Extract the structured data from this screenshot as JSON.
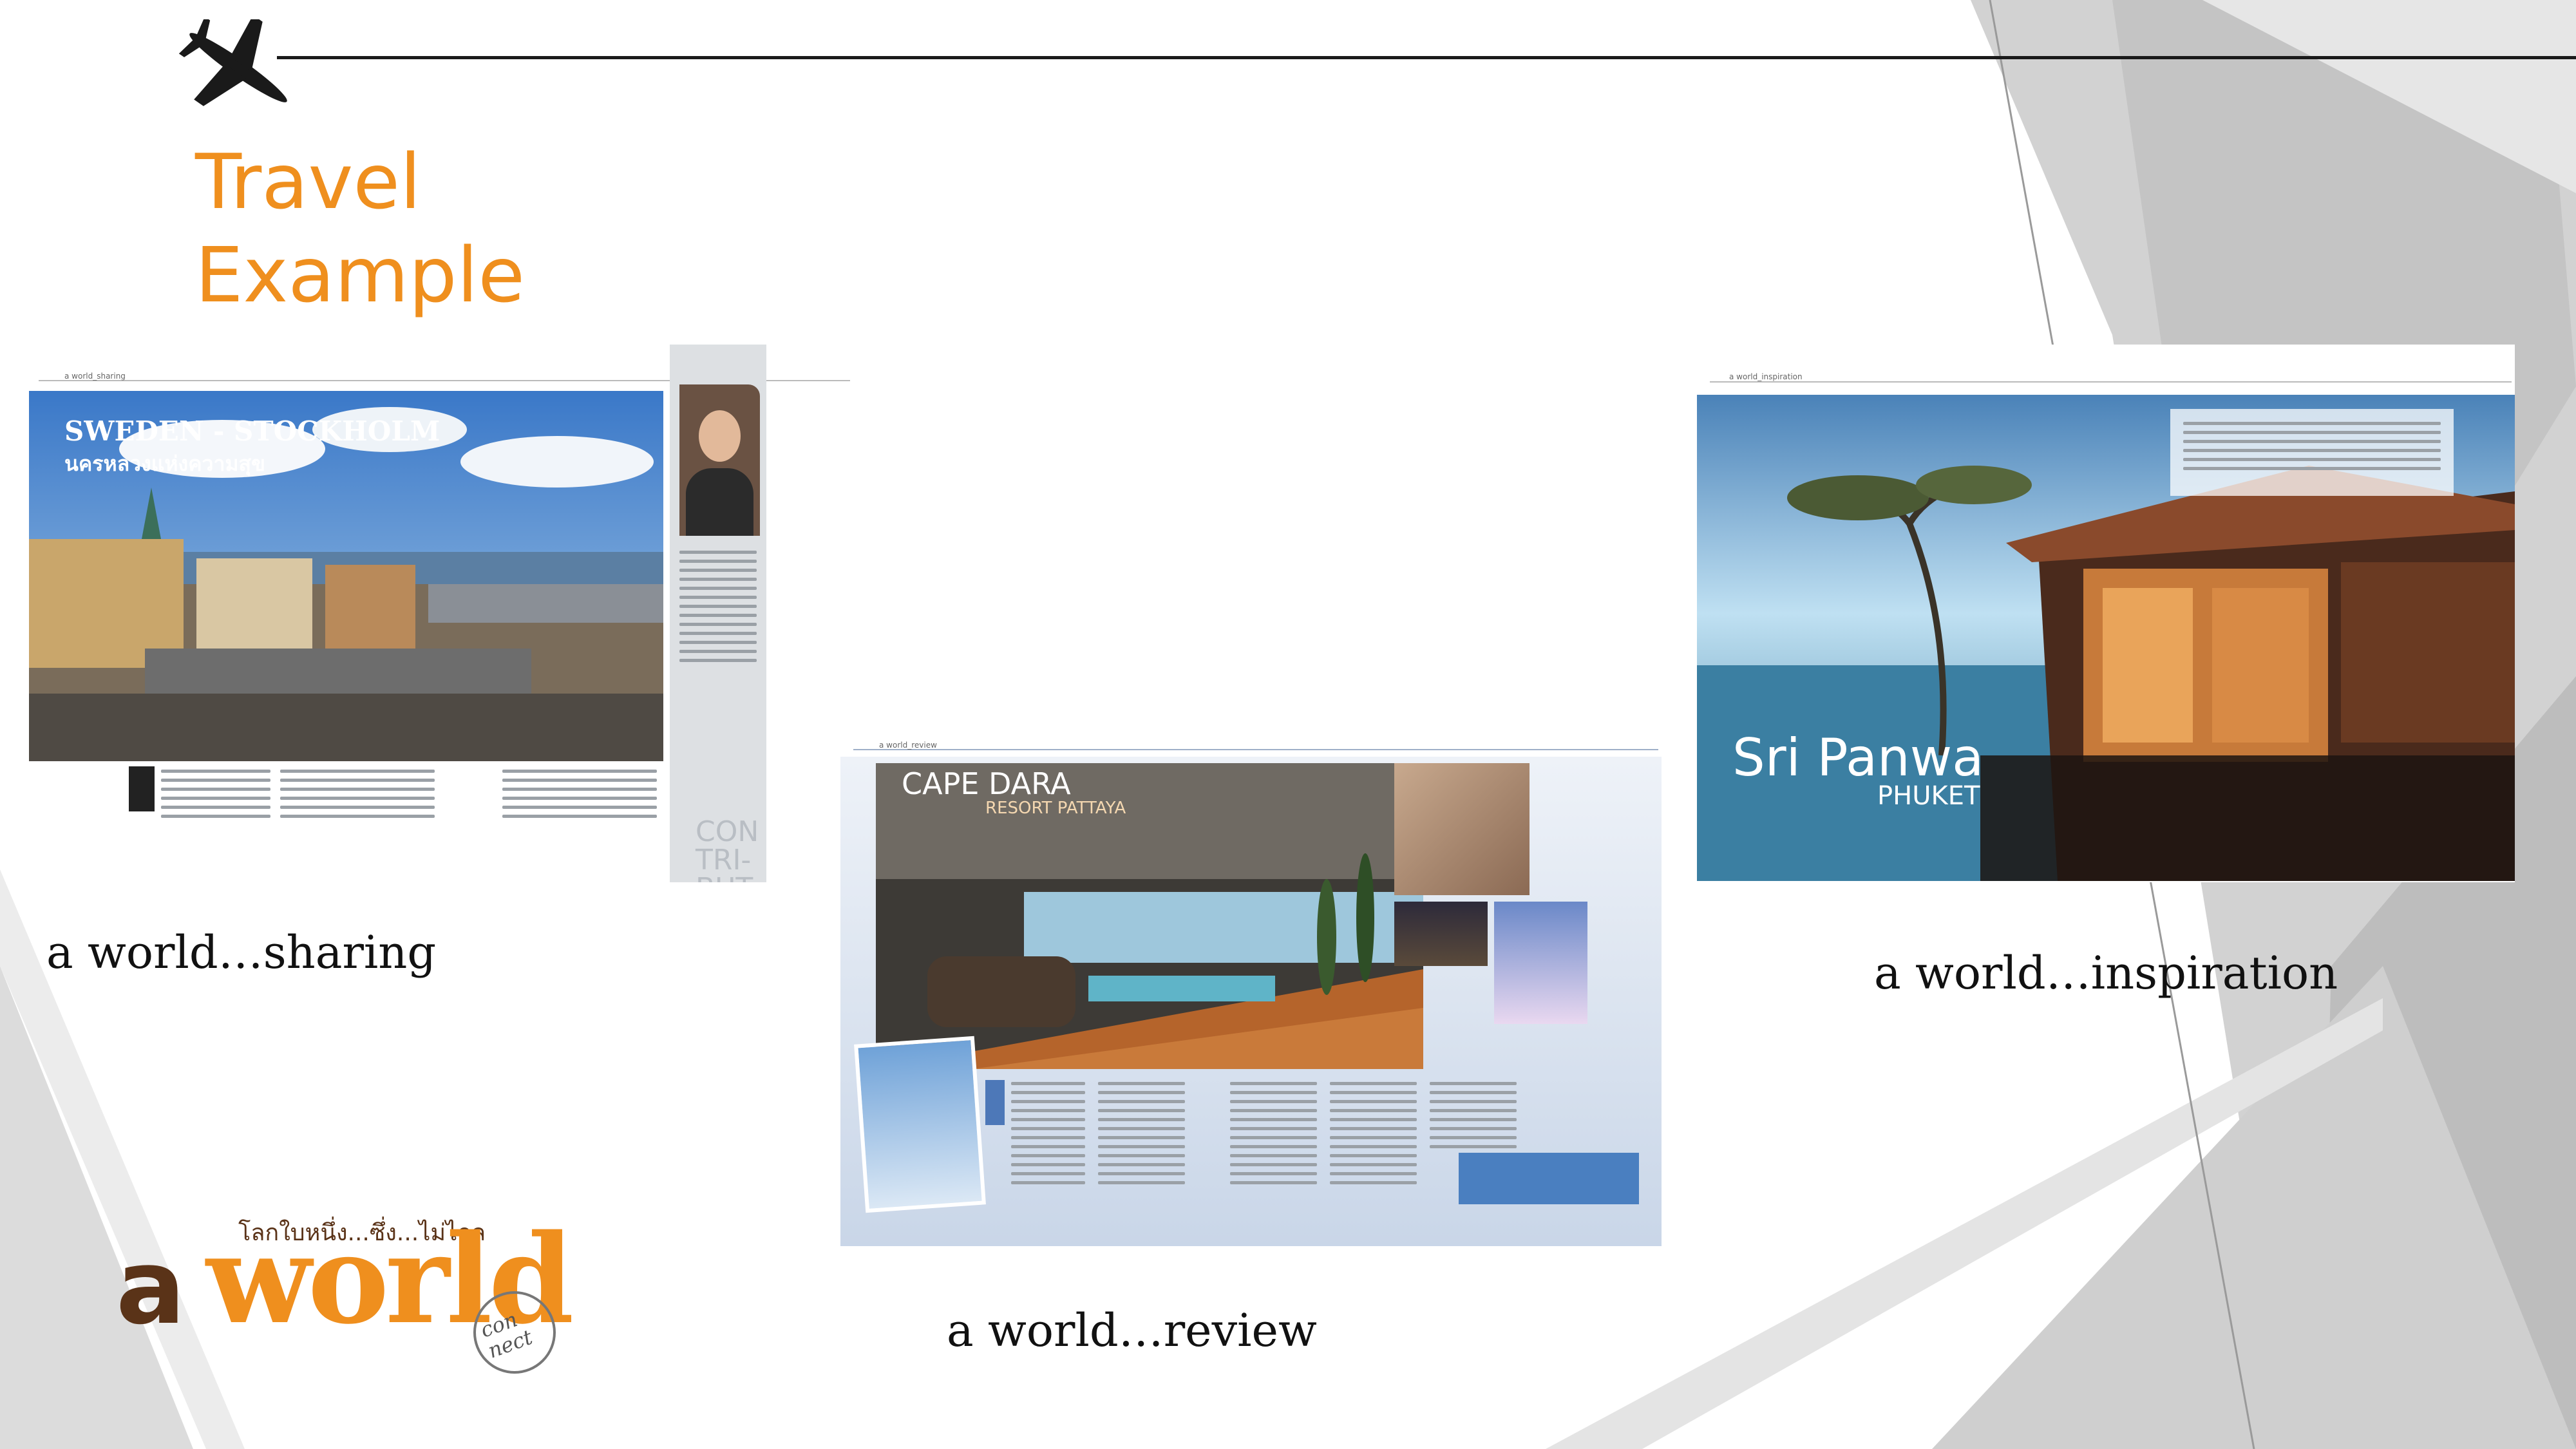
{
  "slide": {
    "title_line1": "Travel",
    "title_line2": "Example",
    "colors": {
      "accent": "#ef8f1e",
      "brand_brown": "#5a3318",
      "background_gray": "#d2d2d2"
    }
  },
  "spread_sharing": {
    "section_label": "a world_sharing",
    "headline": "SWEDEN - STOCKHOLM",
    "subheadline": "นครหลวงแห่งความสุข",
    "contributor_word": "CONTRI-BUTOR",
    "caption": "a world…sharing"
  },
  "spread_review": {
    "section_label": "a world_review",
    "headline": "CAPE DARA",
    "subheadline": "RESORT PATTAYA",
    "caption": "a world…review"
  },
  "spread_inspiration": {
    "section_label": "a world_inspiration",
    "headline": "Sri Panwa",
    "subheadline": "PHUKET",
    "caption": "a world…inspiration"
  },
  "logo": {
    "tagline": "โลกใบหนึ่ง...ซึ่ง...ไม่ไกล",
    "word_a": "a",
    "word_world": "world",
    "word_connect": "con nect"
  },
  "icons": [
    "airplane-icon"
  ]
}
